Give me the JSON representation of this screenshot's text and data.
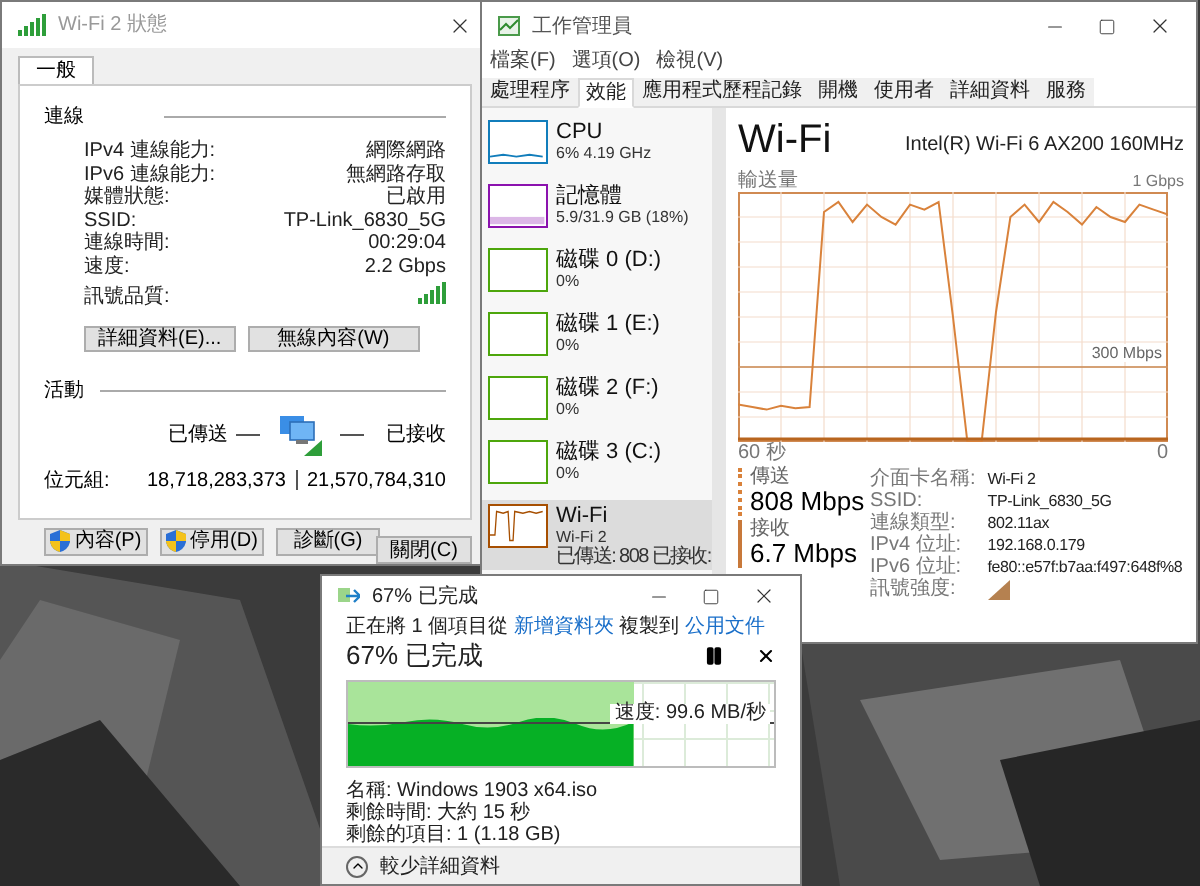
{
  "wifi_status": {
    "title": "Wi-Fi 2 狀態",
    "tabs": [
      {
        "label": "一般",
        "selected": true
      }
    ],
    "connection": {
      "heading": "連線",
      "rows": [
        {
          "label": "IPv4 連線能力:",
          "value": "網際網路"
        },
        {
          "label": "IPv6 連線能力:",
          "value": "無網路存取"
        },
        {
          "label": "媒體狀態:",
          "value": "已啟用"
        },
        {
          "label": "SSID:",
          "value": "TP-Link_6830_5G"
        },
        {
          "label": "連線時間:",
          "value": "00:29:04"
        },
        {
          "label": "速度:",
          "value": "2.2 Gbps"
        }
      ],
      "signal_label": "訊號品質:"
    },
    "buttons": [
      "詳細資料(E)...",
      "無線內容(W)"
    ],
    "activity": {
      "heading": "活動",
      "sent_label": "已傳送",
      "received_label": "已接收",
      "bytes_label": "位元組:",
      "sent": "18,718,283,373",
      "received": "21,570,784,310"
    },
    "actions": [
      {
        "label": "內容(P)",
        "shield": true
      },
      {
        "label": "停用(D)",
        "shield": true
      },
      {
        "label": "診斷(G)",
        "shield": false
      }
    ],
    "close_button": "關閉(C)"
  },
  "task_manager": {
    "title": "工作管理員",
    "menu": [
      "檔案(F)",
      "選項(O)",
      "檢視(V)"
    ],
    "tabs": [
      {
        "label": "處理程序",
        "selected": false
      },
      {
        "label": "效能",
        "selected": true
      },
      {
        "label": "應用程式歷程記錄",
        "selected": false
      },
      {
        "label": "開機",
        "selected": false
      },
      {
        "label": "使用者",
        "selected": false
      },
      {
        "label": "詳細資料",
        "selected": false
      },
      {
        "label": "服務",
        "selected": false
      }
    ],
    "sidebar": [
      {
        "kind": "cpu",
        "name": "CPU",
        "detail": "6% 4.19 GHz",
        "color": "#117dbb",
        "selected": false
      },
      {
        "kind": "memory",
        "name": "記憶體",
        "detail": "5.9/31.9 GB (18%)",
        "color": "#8b12ae",
        "selected": false
      },
      {
        "kind": "disk",
        "name": "磁碟 0 (D:)",
        "detail": "0%",
        "color": "#4da60c",
        "selected": false
      },
      {
        "kind": "disk",
        "name": "磁碟 1 (E:)",
        "detail": "0%",
        "color": "#4da60c",
        "selected": false
      },
      {
        "kind": "disk",
        "name": "磁碟 2 (F:)",
        "detail": "0%",
        "color": "#4da60c",
        "selected": false
      },
      {
        "kind": "disk",
        "name": "磁碟 3 (C:)",
        "detail": "0%",
        "color": "#4da60c",
        "selected": false
      },
      {
        "kind": "network",
        "name": "Wi-Fi",
        "subname": "Wi-Fi 2",
        "detail": "已傳送: 808 已接收:",
        "color": "#a74f01",
        "selected": true
      }
    ],
    "panel": {
      "title": "Wi-Fi",
      "adapter": "Intel(R) Wi-Fi 6 AX200 160MHz",
      "graph": {
        "ylabel": "輸送量",
        "scale": "1 Gbps",
        "reference": "300 Mbps",
        "start": "60 秒",
        "end": "0"
      },
      "send": {
        "label": "傳送",
        "value": "808 Mbps"
      },
      "receive": {
        "label": "接收",
        "value": "6.7 Mbps"
      },
      "details": [
        {
          "label": "介面卡名稱:",
          "value": "Wi-Fi 2"
        },
        {
          "label": "SSID:",
          "value": "TP-Link_6830_5G"
        },
        {
          "label": "連線類型:",
          "value": "802.11ax"
        },
        {
          "label": "IPv4 位址:",
          "value": "192.168.0.179"
        },
        {
          "label": "IPv6 位址:",
          "value": "fe80::e57f:b7aa:f497:648f%8"
        }
      ],
      "signal_label": "訊號強度:"
    }
  },
  "copy_dialog": {
    "title": "67% 已完成",
    "summary": {
      "prefix": "正在將 1 個項目從",
      "source": "新增資料夾",
      "middle": "複製到",
      "destination": "公用文件"
    },
    "heading": "67% 已完成",
    "level": 0.67,
    "speed": "速度: 99.6 MB/秒",
    "details": [
      "名稱: Windows 1903 x64.iso",
      "剩餘時間: 大約 15 秒",
      "剩餘的項目: 1 (1.18 GB)"
    ],
    "toggle": "較少詳細資料"
  }
}
